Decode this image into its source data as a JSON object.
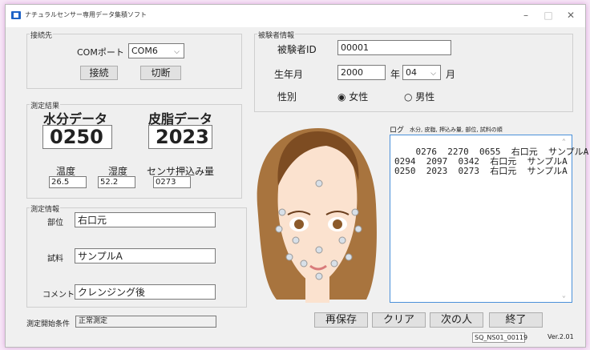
{
  "window": {
    "title": "ナチュラルセンサー専用データ集積ソフト",
    "min": "–",
    "max": "□",
    "close": "✕"
  },
  "connection": {
    "group_label": "接続先",
    "port_label": "COMポート",
    "port_value": "COM6",
    "connect_label": "接続",
    "disconnect_label": "切断"
  },
  "subject": {
    "group_label": "被験者情報",
    "id_label": "被験者ID",
    "id_value": "00001",
    "birth_label": "生年月",
    "year_value": "2000",
    "year_suffix": "年",
    "month_value": "04",
    "month_suffix": "月",
    "gender_label": "性別",
    "female_label": "◉ 女性",
    "male_label": "○ 男性"
  },
  "result": {
    "group_label": "測定結果",
    "moisture_label": "水分データ",
    "moisture_value": "0250",
    "sebum_label": "皮脂データ",
    "sebum_value": "2023",
    "temp_label": "温度",
    "temp_value": "26.5",
    "humidity_label": "湿度",
    "humidity_value": "52.2",
    "pressure_label": "センサ押込み量",
    "pressure_value": "0273"
  },
  "info": {
    "group_label": "測定情報",
    "site_label": "部位",
    "site_value": "右口元",
    "sample_label": "試料",
    "sample_value": "サンプルA",
    "comment_label": "コメント",
    "comment_value": "クレンジング後"
  },
  "start": {
    "label": "測定開始条件",
    "value": "正常測定"
  },
  "log": {
    "label": "ログ",
    "header": "水分, 皮脂, 押込み量, 部位, 試料の順",
    "lines": "0276  2270  0655  右口元  サンプルA\n0294  2097  0342  右口元  サンプルA\n0250  2023  0273  右口元  サンプルA"
  },
  "buttons": {
    "resave": "再保存",
    "clear": "クリア",
    "next": "次の人",
    "exit": "終了"
  },
  "status": {
    "device": "SQ_NS01_00119",
    "version": "Ver.2.01"
  }
}
